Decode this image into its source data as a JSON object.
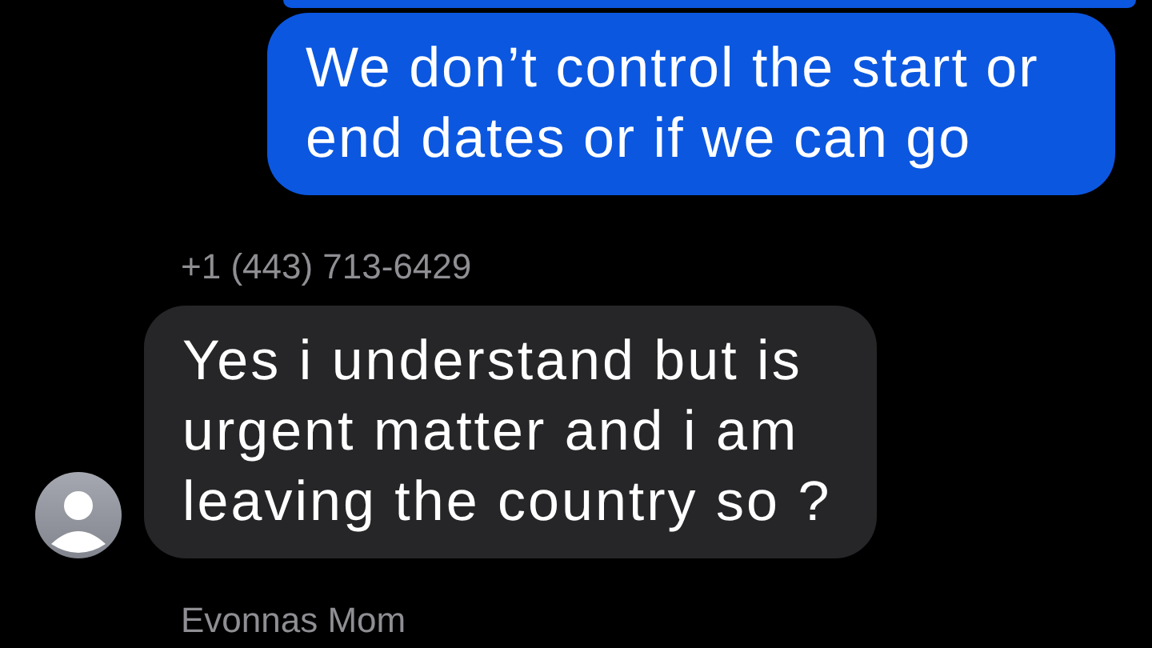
{
  "messages": [
    {
      "kind": "outgoing",
      "text": "We don’t control the start or end dates or if we can go"
    },
    {
      "kind": "incoming",
      "sender": "+1 (443) 713-6429",
      "text": "Yes i understand but is urgent matter and i am leaving the country so ?"
    },
    {
      "kind": "incoming",
      "sender": "Evonnas Mom"
    }
  ]
}
